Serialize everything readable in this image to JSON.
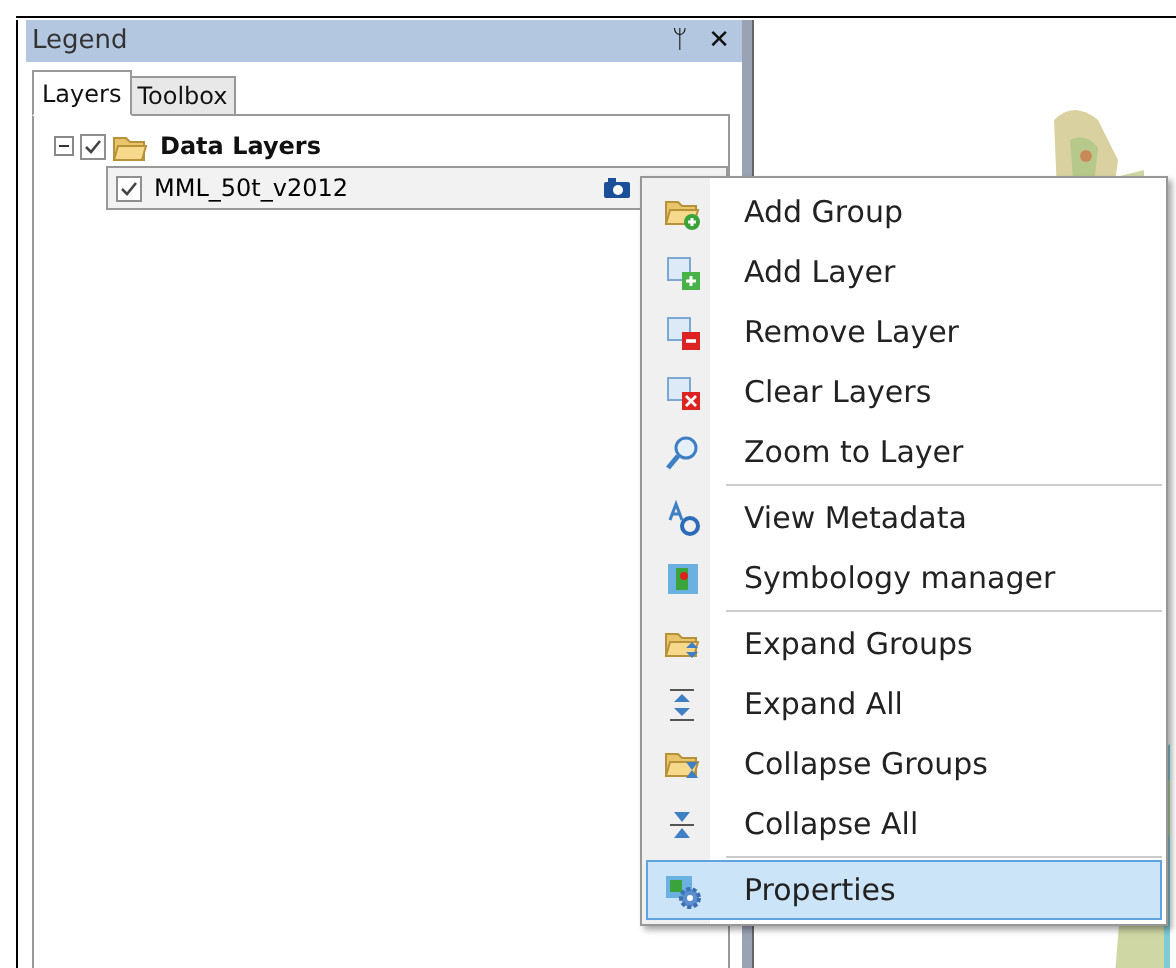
{
  "legend": {
    "title": "Legend",
    "pin": "ᛘ",
    "close": "✕",
    "tabs": [
      {
        "label": "Layers",
        "selected": true
      },
      {
        "label": "Toolbox",
        "selected": false
      }
    ],
    "tree": [
      {
        "label": "Data Layers",
        "kind": "group",
        "expanded": true,
        "checked": true,
        "selected": false,
        "children": [
          {
            "label": "MML_50t_v2012",
            "kind": "layer",
            "checked": true,
            "selected": true
          }
        ]
      }
    ]
  },
  "context_menu": [
    {
      "kind": "item",
      "label": "Add Group",
      "selected": false
    },
    {
      "kind": "item",
      "label": "Add Layer",
      "selected": false
    },
    {
      "kind": "item",
      "label": "Remove Layer",
      "selected": false
    },
    {
      "kind": "item",
      "label": "Clear Layers",
      "selected": false
    },
    {
      "kind": "item",
      "label": "Zoom to Layer",
      "selected": false
    },
    {
      "kind": "separator"
    },
    {
      "kind": "item",
      "label": "View Metadata",
      "selected": false
    },
    {
      "kind": "item",
      "label": "Symbology manager",
      "selected": false
    },
    {
      "kind": "separator"
    },
    {
      "kind": "item",
      "label": "Expand Groups",
      "selected": false
    },
    {
      "kind": "item",
      "label": "Expand All",
      "selected": false
    },
    {
      "kind": "item",
      "label": "Collapse Groups",
      "selected": false
    },
    {
      "kind": "item",
      "label": "Collapse All",
      "selected": false
    },
    {
      "kind": "separator"
    },
    {
      "kind": "item",
      "label": "Properties",
      "selected": true
    }
  ]
}
